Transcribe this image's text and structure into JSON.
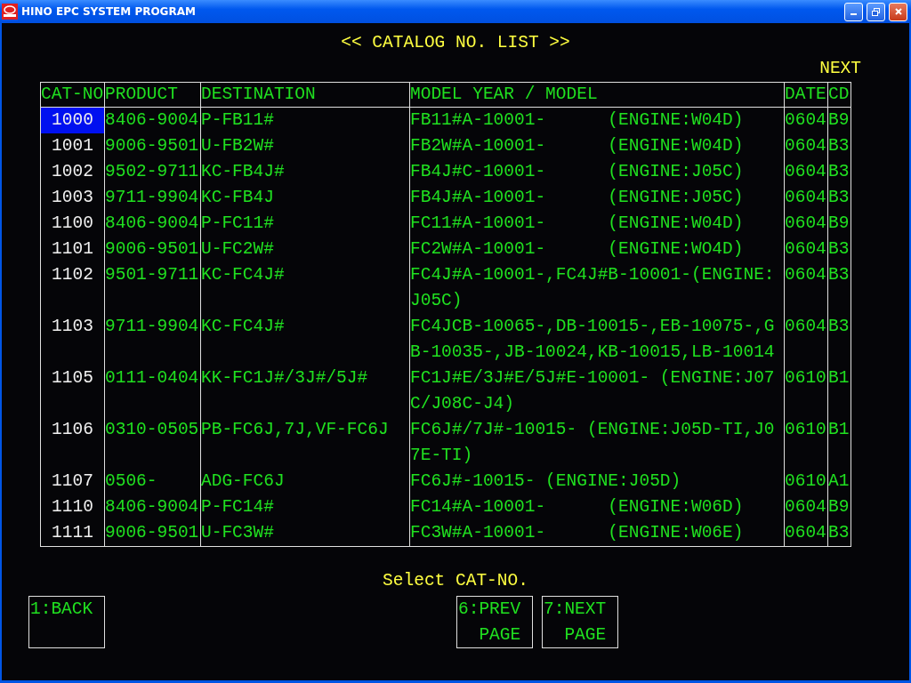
{
  "window": {
    "title": "HINO EPC SYSTEM PROGRAM"
  },
  "screen_title": "<< CATALOG NO. LIST >>",
  "next_label": "NEXT",
  "table": {
    "columns": [
      "CAT-NO",
      "PRODUCT",
      "DESTINATION",
      "MODEL YEAR / MODEL",
      "DATE",
      "CD"
    ],
    "rows": [
      {
        "cat_no": "1000",
        "product": "8406-9004",
        "destination": "P-FB11#",
        "model": "FB11#A-10001-      (ENGINE:W04D)",
        "date": "0604",
        "cd": "B9",
        "selected": true
      },
      {
        "cat_no": "1001",
        "product": "9006-9501",
        "destination": "U-FB2W#",
        "model": "FB2W#A-10001-      (ENGINE:W04D)",
        "date": "0604",
        "cd": "B3",
        "selected": false
      },
      {
        "cat_no": "1002",
        "product": "9502-9711",
        "destination": "KC-FB4J#",
        "model": "FB4J#C-10001-      (ENGINE:J05C)",
        "date": "0604",
        "cd": "B3",
        "selected": false
      },
      {
        "cat_no": "1003",
        "product": "9711-9904",
        "destination": "KC-FB4J",
        "model": "FB4J#A-10001-      (ENGINE:J05C)",
        "date": "0604",
        "cd": "B3",
        "selected": false
      },
      {
        "cat_no": "1100",
        "product": "8406-9004",
        "destination": "P-FC11#",
        "model": "FC11#A-10001-      (ENGINE:W04D)",
        "date": "0604",
        "cd": "B9",
        "selected": false
      },
      {
        "cat_no": "1101",
        "product": "9006-9501",
        "destination": "U-FC2W#",
        "model": "FC2W#A-10001-      (ENGINE:WO4D)",
        "date": "0604",
        "cd": "B3",
        "selected": false
      },
      {
        "cat_no": "1102",
        "product": "9501-9711",
        "destination": "KC-FC4J#",
        "model": "FC4J#A-10001-,FC4J#B-10001-(ENGINE:J05C)",
        "date": "0604",
        "cd": "B3",
        "selected": false
      },
      {
        "cat_no": "1103",
        "product": "9711-9904",
        "destination": "KC-FC4J#",
        "model": "FC4JCB-10065-,DB-10015-,EB-10075-,GB-10035-,JB-10024,KB-10015,LB-10014",
        "date": "0604",
        "cd": "B3",
        "selected": false
      },
      {
        "cat_no": "1105",
        "product": "0111-0404",
        "destination": "KK-FC1J#/3J#/5J#",
        "model": "FC1J#E/3J#E/5J#E-10001- (ENGINE:J07C/J08C-J4)",
        "date": "0610",
        "cd": "B1",
        "selected": false
      },
      {
        "cat_no": "1106",
        "product": "0310-0505",
        "destination": "PB-FC6J,7J,VF-FC6J",
        "model": "FC6J#/7J#-10015- (ENGINE:J05D-TI,J07E-TI)",
        "date": "0610",
        "cd": "B1",
        "selected": false
      },
      {
        "cat_no": "1107",
        "product": "0506-",
        "destination": "ADG-FC6J",
        "model": "FC6J#-10015- (ENGINE:J05D)",
        "date": "0610",
        "cd": "A1",
        "selected": false
      },
      {
        "cat_no": "1110",
        "product": "8406-9004",
        "destination": "P-FC14#",
        "model": "FC14#A-10001-      (ENGINE:W06D)",
        "date": "0604",
        "cd": "B9",
        "selected": false
      },
      {
        "cat_no": "1111",
        "product": "9006-9501",
        "destination": "U-FC3W#",
        "model": "FC3W#A-10001-      (ENGINE:W06E)",
        "date": "0604",
        "cd": "B3",
        "selected": false
      }
    ]
  },
  "prompt": "Select CAT-NO.",
  "buttons": [
    {
      "label": "1:BACK"
    },
    {
      "label": "6:PREV\n  PAGE"
    },
    {
      "label": "7:NEXT\n  PAGE"
    }
  ]
}
